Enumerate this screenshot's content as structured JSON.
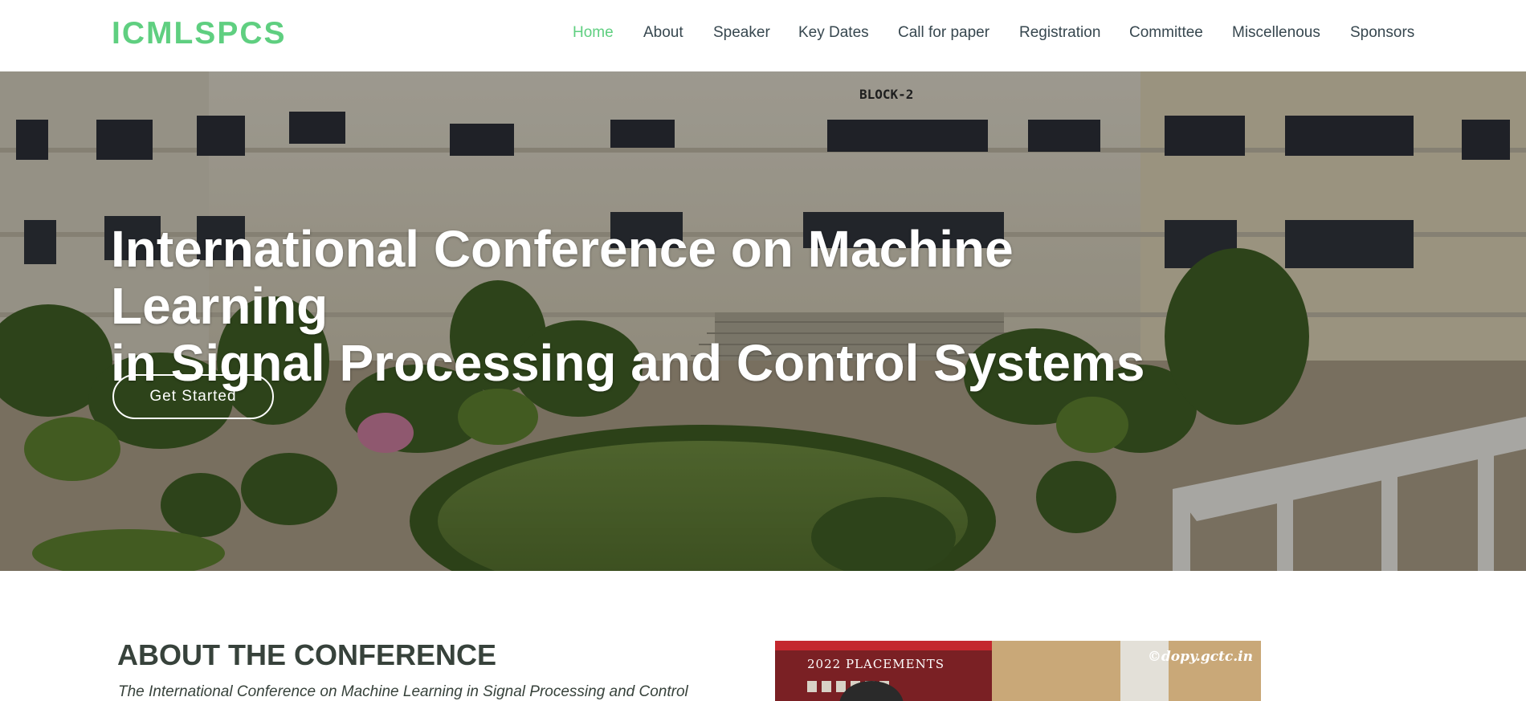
{
  "header": {
    "logo": "ICMLSPCS",
    "nav": [
      {
        "label": "Home",
        "active": true
      },
      {
        "label": "About",
        "active": false
      },
      {
        "label": "Speaker",
        "active": false
      },
      {
        "label": "Key Dates",
        "active": false
      },
      {
        "label": "Call for paper",
        "active": false
      },
      {
        "label": "Registration",
        "active": false
      },
      {
        "label": "Committee",
        "active": false
      },
      {
        "label": "Miscellenous",
        "active": false
      },
      {
        "label": "Sponsors",
        "active": false
      }
    ]
  },
  "hero": {
    "title_line1": "International Conference on Machine Learning",
    "title_line2": "in Signal Processing and Control Systems",
    "cta_label": "Get Started",
    "building_sign": "BLOCK-2"
  },
  "about": {
    "heading": "ABOUT THE CONFERENCE",
    "intro": "The International Conference on Machine Learning in Signal Processing and Control",
    "photo_credit": "©dopy.gctc.in",
    "photo_banner": "2022 PLACEMENTS"
  },
  "colors": {
    "accent": "#5fcf80",
    "nav_text": "#37474f",
    "heading": "#37423b"
  }
}
